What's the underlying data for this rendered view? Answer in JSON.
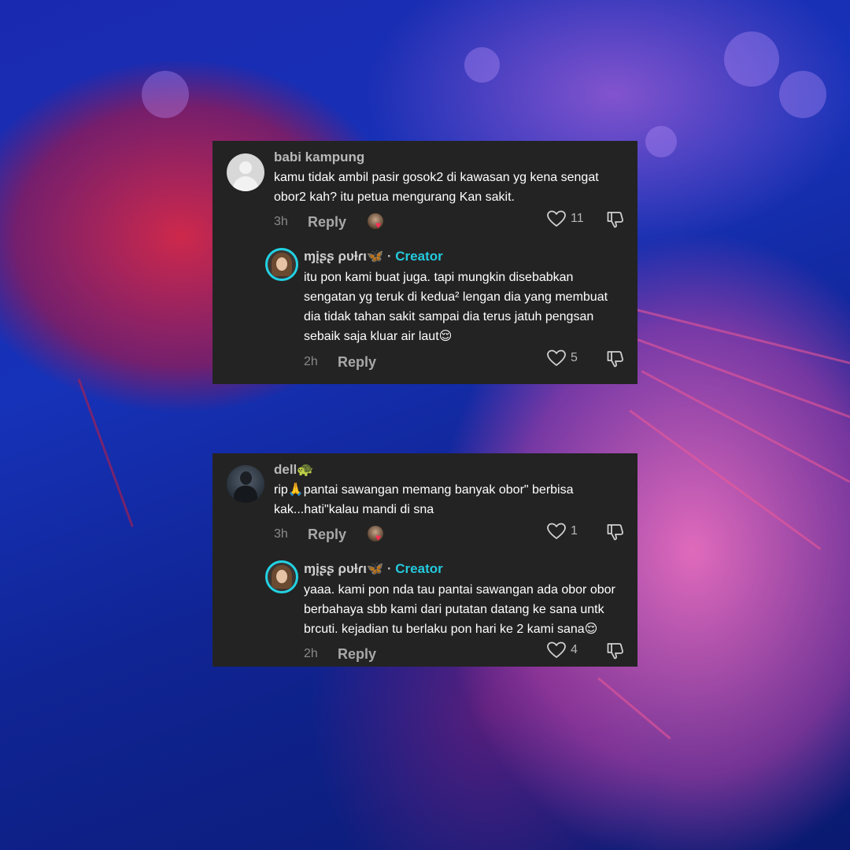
{
  "comments": [
    {
      "username": "babi kampung",
      "text_line1": "kamu tidak ambil pasir gosok2 di kawasan yg kena sengat",
      "text_line2": "obor2 kah? itu petua mengurang Kan sakit.",
      "time": "3h",
      "reply_label": "Reply",
      "likes": "11",
      "reply": {
        "username": "ɱįʂʂ ρυƚɾι🦋",
        "separator": "·",
        "badge": "Creator",
        "text_line1": "itu pon kami buat juga. tapi mungkin disebabkan",
        "text_line2": "sengatan yg teruk di kedua² lengan dia yang membuat",
        "text_line3": "dia tidak tahan sakit sampai dia terus jatuh pengsan",
        "text_line4": "sebaik saja kluar air laut😌",
        "time": "2h",
        "reply_label": "Reply",
        "likes": "5"
      }
    },
    {
      "username": "dell🐢",
      "text_line1": "rip🙏pantai sawangan memang banyak obor\" berbisa",
      "text_line2": "kak...hati\"kalau mandi di sna",
      "time": "3h",
      "reply_label": "Reply",
      "likes": "1",
      "reply": {
        "username": "ɱįʂʂ ρυƚɾι🦋",
        "separator": "·",
        "badge": "Creator",
        "text_line1": "yaaa. kami pon nda tau pantai sawangan ada obor obor",
        "text_line2": "berbahaya sbb kami dari putatan datang ke sana untk",
        "text_line3": "brcuti. kejadian tu berlaku pon hari ke 2 kami sana😌",
        "time": "2h",
        "reply_label": "Reply",
        "likes": "4"
      }
    }
  ],
  "icons": {
    "like": "heart-outline-icon",
    "dislike": "thumbs-down-outline-icon",
    "liked_by_creator": "creator-liked-badge"
  },
  "colors": {
    "card_bg": "#232323",
    "creator_accent": "#25c9dd",
    "liked_heart": "#ff2e55"
  }
}
